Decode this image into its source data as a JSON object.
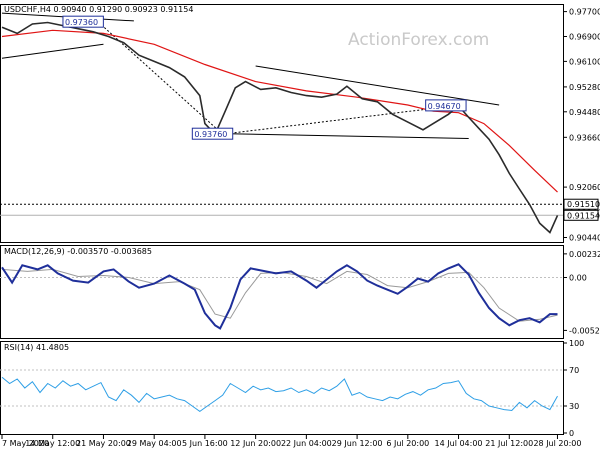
{
  "chart_data": [
    {
      "type": "candlestick",
      "header": "USDCHF,H4  0.90940 0.91290 0.90923 0.91154",
      "watermark": "ActionForex.com",
      "y_ticks": [
        "0.97700",
        "0.96900",
        "0.96100",
        "0.95280",
        "0.94480",
        "0.93660",
        "0.92060",
        "0.91240",
        "0.90440"
      ],
      "y_tick_values": [
        0.977,
        0.969,
        0.961,
        0.9528,
        0.9448,
        0.9366,
        0.9206,
        0.9124,
        0.9044
      ],
      "ylim": [
        0.9036,
        0.9788
      ],
      "x_ticks": [
        "7 May 2020",
        "14 May 12:00",
        "21 May 20:00",
        "29 May 04:00",
        "5 Jun 16:00",
        "12 Jun 20:00",
        "22 Jun 04:00",
        "29 Jun 12:00",
        "6 Jul 20:00",
        "14 Jul 04:00",
        "21 Jul 12:00",
        "28 Jul 20:00"
      ],
      "price_series": [
        [
          0,
          0.972
        ],
        [
          6,
          0.97
        ],
        [
          12,
          0.973
        ],
        [
          18,
          0.9735
        ],
        [
          24,
          0.9725
        ],
        [
          30,
          0.9715
        ],
        [
          36,
          0.9705
        ],
        [
          42,
          0.969
        ],
        [
          48,
          0.967
        ],
        [
          54,
          0.963
        ],
        [
          60,
          0.961
        ],
        [
          66,
          0.959
        ],
        [
          72,
          0.956
        ],
        [
          78,
          0.95
        ],
        [
          80,
          0.941
        ],
        [
          84,
          0.9376
        ],
        [
          88,
          0.945
        ],
        [
          92,
          0.9525
        ],
        [
          96,
          0.9545
        ],
        [
          102,
          0.952
        ],
        [
          108,
          0.9525
        ],
        [
          114,
          0.951
        ],
        [
          120,
          0.95
        ],
        [
          126,
          0.9495
        ],
        [
          132,
          0.9505
        ],
        [
          136,
          0.953
        ],
        [
          142,
          0.949
        ],
        [
          148,
          0.948
        ],
        [
          154,
          0.944
        ],
        [
          160,
          0.9415
        ],
        [
          166,
          0.939
        ],
        [
          170,
          0.941
        ],
        [
          176,
          0.944
        ],
        [
          180,
          0.9467
        ],
        [
          184,
          0.943
        ],
        [
          188,
          0.9395
        ],
        [
          192,
          0.936
        ],
        [
          196,
          0.931
        ],
        [
          200,
          0.925
        ],
        [
          204,
          0.92
        ],
        [
          208,
          0.915
        ],
        [
          212,
          0.909
        ],
        [
          216,
          0.906
        ],
        [
          219,
          0.9115
        ]
      ],
      "ema_series": [
        [
          0,
          0.969
        ],
        [
          20,
          0.971
        ],
        [
          40,
          0.97
        ],
        [
          60,
          0.9665
        ],
        [
          80,
          0.96
        ],
        [
          100,
          0.9545
        ],
        [
          120,
          0.9515
        ],
        [
          140,
          0.9495
        ],
        [
          160,
          0.947
        ],
        [
          170,
          0.945
        ],
        [
          180,
          0.9445
        ],
        [
          190,
          0.941
        ],
        [
          200,
          0.934
        ],
        [
          210,
          0.926
        ],
        [
          219,
          0.919
        ]
      ],
      "trendlines": [
        {
          "from": [
            0,
            0.962
          ],
          "to": [
            40,
            0.9665
          ]
        },
        {
          "from": [
            0,
            0.9765
          ],
          "to": [
            52,
            0.974
          ]
        },
        {
          "from": [
            100,
            0.9595
          ],
          "to": [
            196,
            0.947
          ]
        },
        {
          "from": [
            87,
            0.9378
          ],
          "to": [
            184,
            0.9362
          ]
        }
      ],
      "dotted_lines": [
        {
          "from": [
            38,
            0.9736
          ],
          "to": [
            87,
            0.9376
          ]
        },
        {
          "from": [
            87,
            0.9376
          ],
          "to": [
            178,
            0.9467
          ]
        }
      ],
      "labels": [
        {
          "text": "0.97360",
          "x": 32,
          "y": 0.9736
        },
        {
          "text": "0.93760",
          "x": 83,
          "y": 0.9376
        },
        {
          "text": "0.94670",
          "x": 175,
          "y": 0.9467
        }
      ],
      "hline_value": 0.9151,
      "hline_label": "0.91510",
      "current_value": 0.91154,
      "current_label": "0.91154"
    },
    {
      "type": "line",
      "title": "MACD(12,26,9) -0.003570 -0.003685",
      "y_ticks": [
        "0.002325",
        "0.00",
        "-0.005201"
      ],
      "y_tick_values": [
        0.002325,
        0.0,
        -0.005201
      ],
      "ylim": [
        -0.00585,
        0.003
      ],
      "macd": [
        [
          0,
          0.001
        ],
        [
          4,
          -0.0005
        ],
        [
          8,
          0.0012
        ],
        [
          14,
          0.0008
        ],
        [
          18,
          0.0012
        ],
        [
          22,
          0.0004
        ],
        [
          28,
          -0.0003
        ],
        [
          34,
          -0.0005
        ],
        [
          40,
          0.0006
        ],
        [
          44,
          0.0008
        ],
        [
          50,
          -0.0004
        ],
        [
          54,
          -0.001
        ],
        [
          60,
          -0.0006
        ],
        [
          66,
          0.0002
        ],
        [
          72,
          -0.0006
        ],
        [
          76,
          -0.0012
        ],
        [
          80,
          -0.0035
        ],
        [
          84,
          -0.0047
        ],
        [
          86,
          -0.005
        ],
        [
          90,
          -0.003
        ],
        [
          94,
          -0.0002
        ],
        [
          98,
          0.0009
        ],
        [
          102,
          0.0007
        ],
        [
          108,
          0.0004
        ],
        [
          114,
          0.0006
        ],
        [
          120,
          -0.0003
        ],
        [
          124,
          -0.001
        ],
        [
          128,
          -0.0002
        ],
        [
          132,
          0.0006
        ],
        [
          136,
          0.0012
        ],
        [
          140,
          0.0006
        ],
        [
          144,
          -0.0003
        ],
        [
          148,
          -0.0008
        ],
        [
          152,
          -0.0012
        ],
        [
          156,
          -0.0016
        ],
        [
          160,
          -0.0009
        ],
        [
          164,
          -0.0001
        ],
        [
          168,
          -0.0004
        ],
        [
          172,
          0.0004
        ],
        [
          176,
          0.0009
        ],
        [
          180,
          0.0013
        ],
        [
          184,
          0.0003
        ],
        [
          188,
          -0.0015
        ],
        [
          192,
          -0.003
        ],
        [
          196,
          -0.004
        ],
        [
          200,
          -0.0047
        ],
        [
          204,
          -0.0042
        ],
        [
          208,
          -0.004
        ],
        [
          212,
          -0.0044
        ],
        [
          216,
          -0.0036
        ],
        [
          219,
          -0.0036
        ]
      ],
      "signal": [
        [
          0,
          0.0008
        ],
        [
          10,
          0.0006
        ],
        [
          20,
          0.0008
        ],
        [
          30,
          0.0001
        ],
        [
          40,
          0.0002
        ],
        [
          50,
          0.0
        ],
        [
          60,
          -0.0006
        ],
        [
          70,
          -0.0004
        ],
        [
          78,
          -0.0012
        ],
        [
          84,
          -0.0036
        ],
        [
          90,
          -0.004
        ],
        [
          96,
          -0.0015
        ],
        [
          102,
          0.0004
        ],
        [
          110,
          0.0005
        ],
        [
          120,
          0.0001
        ],
        [
          128,
          -0.0006
        ],
        [
          136,
          0.0006
        ],
        [
          144,
          0.0003
        ],
        [
          152,
          -0.0008
        ],
        [
          160,
          -0.001
        ],
        [
          168,
          -0.0004
        ],
        [
          176,
          0.0004
        ],
        [
          184,
          0.0005
        ],
        [
          190,
          -0.001
        ],
        [
          196,
          -0.003
        ],
        [
          204,
          -0.0043
        ],
        [
          212,
          -0.0041
        ],
        [
          219,
          -0.0037
        ]
      ]
    },
    {
      "type": "line",
      "title": "RSI(14) 41.4805",
      "y_ticks": [
        "100",
        "70",
        "30",
        "0"
      ],
      "y_tick_values": [
        100,
        70,
        30,
        0
      ],
      "ylim": [
        0,
        100
      ],
      "rsi": [
        [
          0,
          62
        ],
        [
          3,
          55
        ],
        [
          6,
          60
        ],
        [
          9,
          50
        ],
        [
          12,
          57
        ],
        [
          15,
          45
        ],
        [
          18,
          55
        ],
        [
          21,
          50
        ],
        [
          24,
          58
        ],
        [
          27,
          52
        ],
        [
          30,
          55
        ],
        [
          33,
          48
        ],
        [
          36,
          52
        ],
        [
          39,
          56
        ],
        [
          42,
          40
        ],
        [
          45,
          36
        ],
        [
          48,
          48
        ],
        [
          51,
          42
        ],
        [
          54,
          34
        ],
        [
          57,
          44
        ],
        [
          60,
          38
        ],
        [
          63,
          40
        ],
        [
          66,
          42
        ],
        [
          69,
          38
        ],
        [
          72,
          36
        ],
        [
          75,
          30
        ],
        [
          78,
          24
        ],
        [
          81,
          30
        ],
        [
          84,
          36
        ],
        [
          87,
          42
        ],
        [
          90,
          55
        ],
        [
          93,
          50
        ],
        [
          96,
          45
        ],
        [
          99,
          52
        ],
        [
          102,
          48
        ],
        [
          105,
          50
        ],
        [
          108,
          46
        ],
        [
          111,
          47
        ],
        [
          114,
          50
        ],
        [
          117,
          45
        ],
        [
          120,
          48
        ],
        [
          123,
          44
        ],
        [
          126,
          50
        ],
        [
          129,
          47
        ],
        [
          132,
          52
        ],
        [
          135,
          60
        ],
        [
          138,
          42
        ],
        [
          141,
          45
        ],
        [
          144,
          40
        ],
        [
          147,
          38
        ],
        [
          150,
          36
        ],
        [
          153,
          40
        ],
        [
          156,
          38
        ],
        [
          159,
          43
        ],
        [
          162,
          46
        ],
        [
          165,
          42
        ],
        [
          168,
          48
        ],
        [
          171,
          50
        ],
        [
          174,
          55
        ],
        [
          177,
          56
        ],
        [
          180,
          58
        ],
        [
          183,
          44
        ],
        [
          186,
          38
        ],
        [
          189,
          36
        ],
        [
          192,
          30
        ],
        [
          195,
          28
        ],
        [
          198,
          26
        ],
        [
          201,
          25
        ],
        [
          204,
          34
        ],
        [
          207,
          28
        ],
        [
          210,
          36
        ],
        [
          213,
          30
        ],
        [
          216,
          26
        ],
        [
          219,
          41
        ]
      ]
    }
  ]
}
